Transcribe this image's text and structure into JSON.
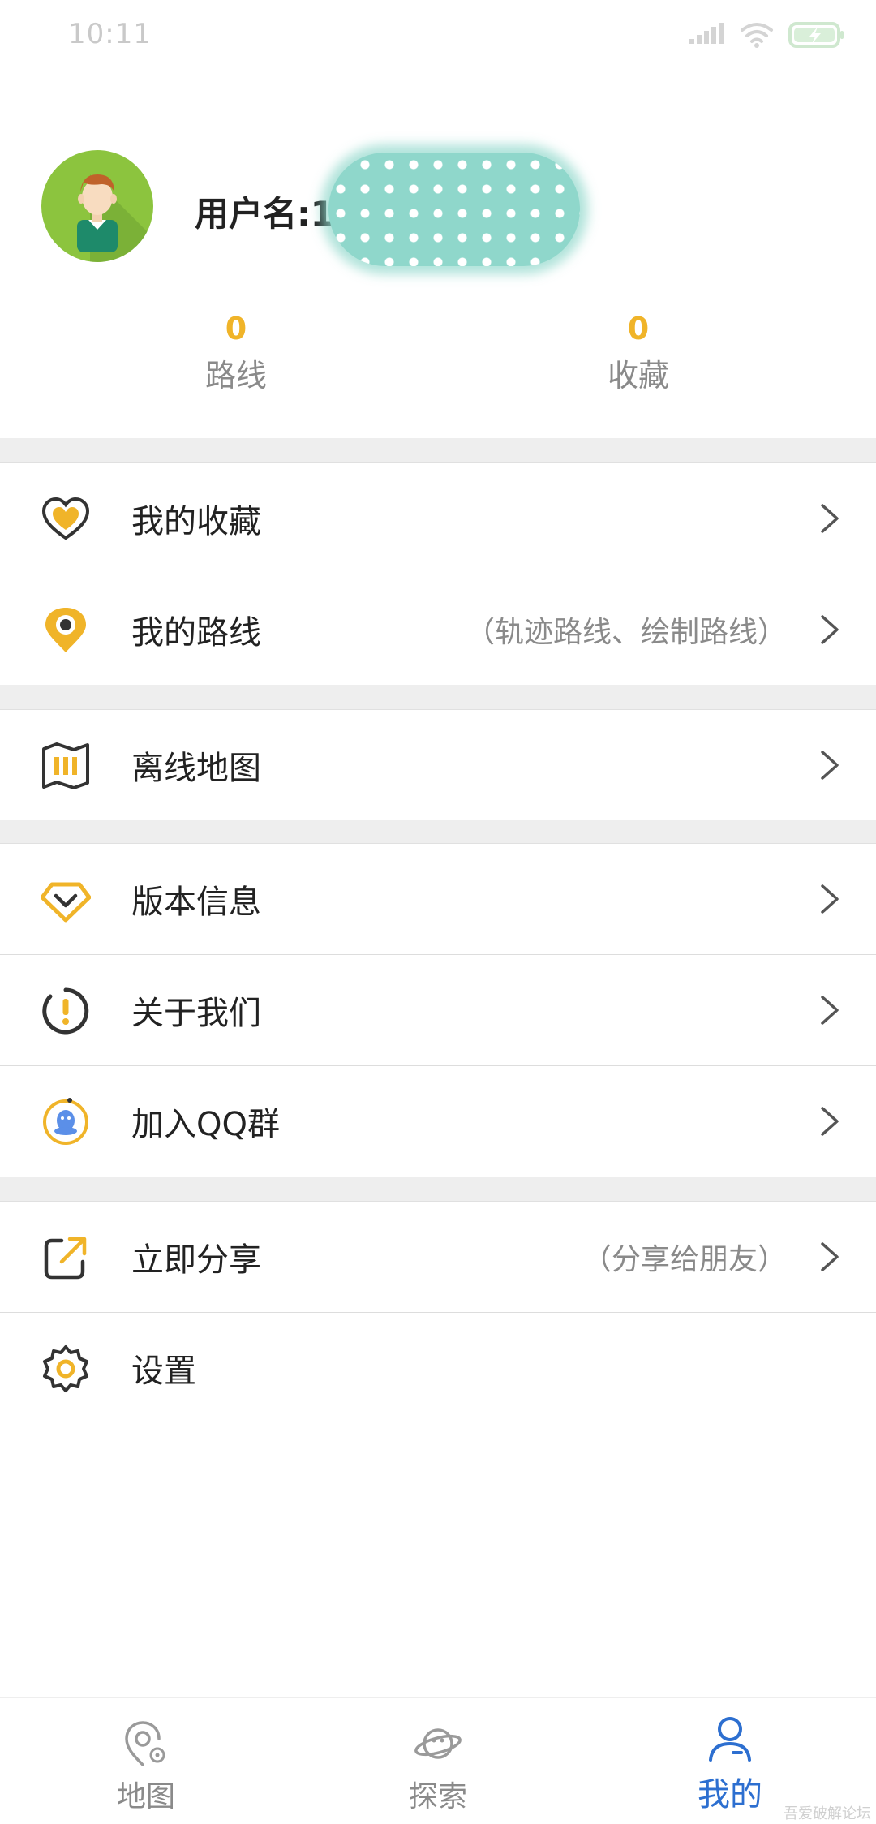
{
  "status_bar": {
    "time": "10:11"
  },
  "profile": {
    "username": "用户名:18",
    "stats": [
      {
        "value": "0",
        "label": "路线"
      },
      {
        "value": "0",
        "label": "收藏"
      }
    ]
  },
  "menu": {
    "favorites": {
      "label": "我的收藏",
      "icon": "heart-icon"
    },
    "routes": {
      "label": "我的路线",
      "hint": "（轨迹路线、绘制路线）",
      "icon": "location-pin-icon"
    },
    "offline_map": {
      "label": "离线地图",
      "icon": "map-icon"
    },
    "version": {
      "label": "版本信息",
      "icon": "diamond-icon"
    },
    "about": {
      "label": "关于我们",
      "icon": "exclamation-circle-icon"
    },
    "qq_group": {
      "label": "加入QQ群",
      "icon": "qq-penguin-icon"
    },
    "share": {
      "label": "立即分享",
      "hint": "（分享给朋友）",
      "icon": "share-icon"
    },
    "settings": {
      "label": "设置",
      "icon": "gear-icon"
    }
  },
  "bottom_nav": {
    "tabs": [
      {
        "label": "地图",
        "icon": "map-pin-icon",
        "active": false
      },
      {
        "label": "探索",
        "icon": "planet-icon",
        "active": false
      },
      {
        "label": "我的",
        "icon": "person-icon",
        "active": true
      }
    ]
  },
  "watermark": "吾爱破解论坛",
  "colors": {
    "accent": "#f0b429",
    "active_tab": "#2d6fd0",
    "divider": "#eeeeee"
  }
}
